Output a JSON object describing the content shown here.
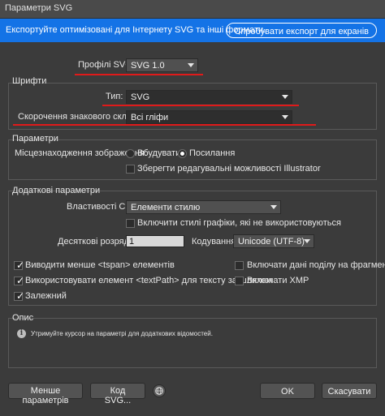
{
  "window": {
    "title": "Параметри SVG"
  },
  "banner": {
    "text": "Експортуйте оптимізовані для Інтернету SVG та інші формати.",
    "button_label": "Спробувати експорт для екранів"
  },
  "profile": {
    "label": "Профілі SVG:",
    "value": "SVG 1.0"
  },
  "fonts": {
    "title": "Шрифти",
    "type_label": "Тип:",
    "type_value": "SVG",
    "subset_label": "Скорочення знакового складу:",
    "subset_value": "Всі гліфи"
  },
  "options": {
    "title": "Параметри",
    "image_location_label": "Місцезнаходження зображення:",
    "embed_label": "Вбудувати",
    "link_label": "Посилання",
    "preserve_label": "Зберегти редагувальні можливості Illustrator"
  },
  "advanced": {
    "title": "Додаткові параметри",
    "css_label": "Властивості CSS:",
    "css_value": "Елементи стилю",
    "include_unused_label": "Включити стилі графіки, які не використовуються",
    "decimal_label": "Десяткові розряди:",
    "decimal_value": "1",
    "encoding_label": "Кодування:",
    "encoding_value": "Unicode (UTF-8)",
    "fewer_tspan_label": "Виводити менше <tspan> елементів",
    "slicing_label": "Включати дані поділу на фрагменти",
    "textpath_label": "Використовувати елемент <textPath> для тексту за шляхом",
    "xmp_label": "Включати XMP",
    "responsive_label": "Залежний"
  },
  "description": {
    "title": "Опис",
    "text": "Утримуйте курсор на параметрі для додаткових відомостей."
  },
  "footer": {
    "less_options_label": "Менше параметрів",
    "svg_code_label": "Код SVG...",
    "ok_label": "OK",
    "cancel_label": "Скасувати"
  },
  "state": {
    "embed_selected": false,
    "link_selected": true,
    "preserve_checked": false,
    "include_unused_checked": false,
    "fewer_tspan_checked": true,
    "slicing_checked": false,
    "textpath_checked": true,
    "xmp_checked": false,
    "responsive_checked": true
  },
  "colors": {
    "accent": "#1473e6",
    "annotation": "#e01a1a",
    "background": "#3b3b3b"
  },
  "icons": [
    "info-icon",
    "globe-icon",
    "chevron-down-icon",
    "checkmark-icon"
  ]
}
